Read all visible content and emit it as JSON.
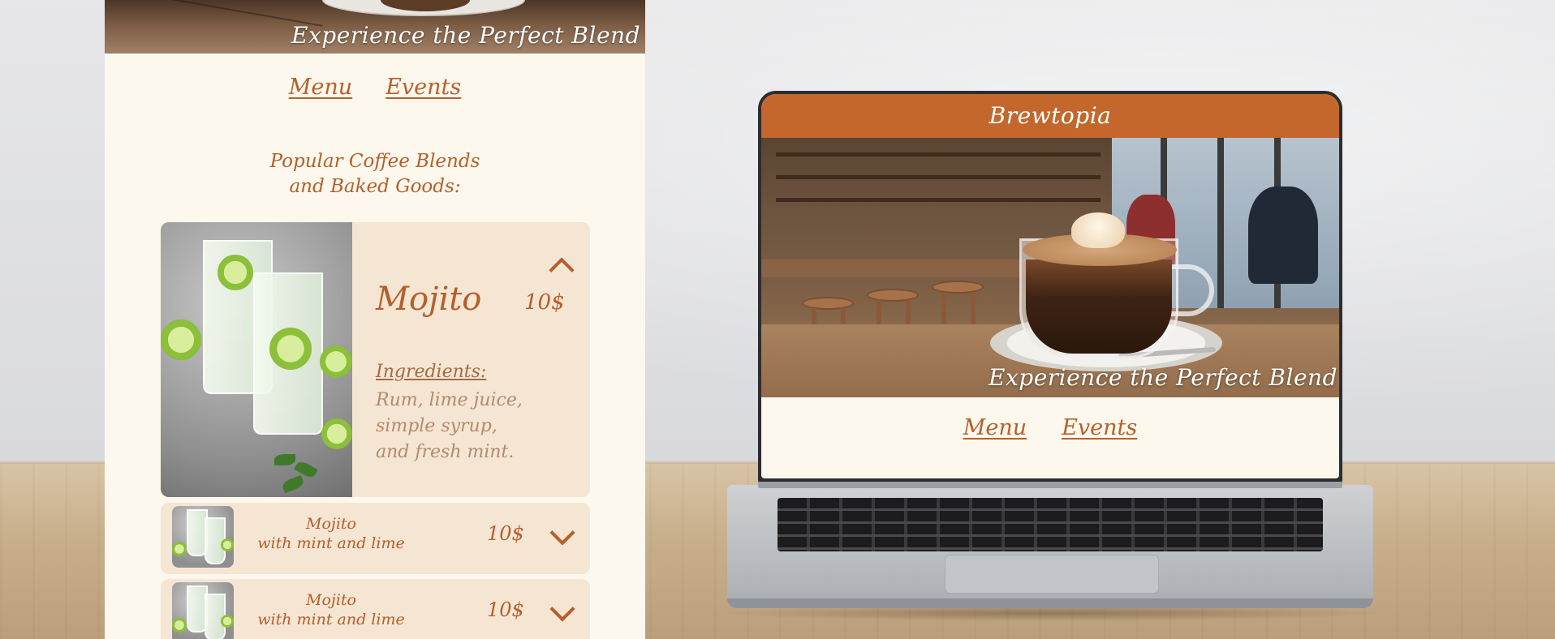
{
  "mobile": {
    "hero_tagline": "Experience the Perfect Blend",
    "nav": {
      "menu": "Menu",
      "events": "Events"
    },
    "heading_line1": "Popular Coffee Blends",
    "heading_line2": "and Baked Goods:",
    "expanded_item": {
      "name": "Mojito",
      "price": "10$",
      "ingredients_label": "Ingredients:",
      "ingredients_line1": "Rum, lime juice,",
      "ingredients_line2": "simple syrup,",
      "ingredients_line3": "and fresh mint."
    },
    "collapsed_items": [
      {
        "name": "Mojito",
        "subtitle": "with mint and lime",
        "price": "10$"
      },
      {
        "name": "Mojito",
        "subtitle": "with mint and lime",
        "price": "10$"
      }
    ]
  },
  "laptop": {
    "brand": "Brewtopia",
    "hero_tagline": "Experience the Perfect Blend",
    "nav": {
      "menu": "Menu",
      "events": "Events"
    }
  },
  "colors": {
    "accent": "#c3672c",
    "text_accent": "#b55e2a",
    "page_bg": "#fdf8ed",
    "card_bg": "#f5e6d3"
  },
  "icons": [
    "chevron-up-icon",
    "chevron-down-icon"
  ]
}
